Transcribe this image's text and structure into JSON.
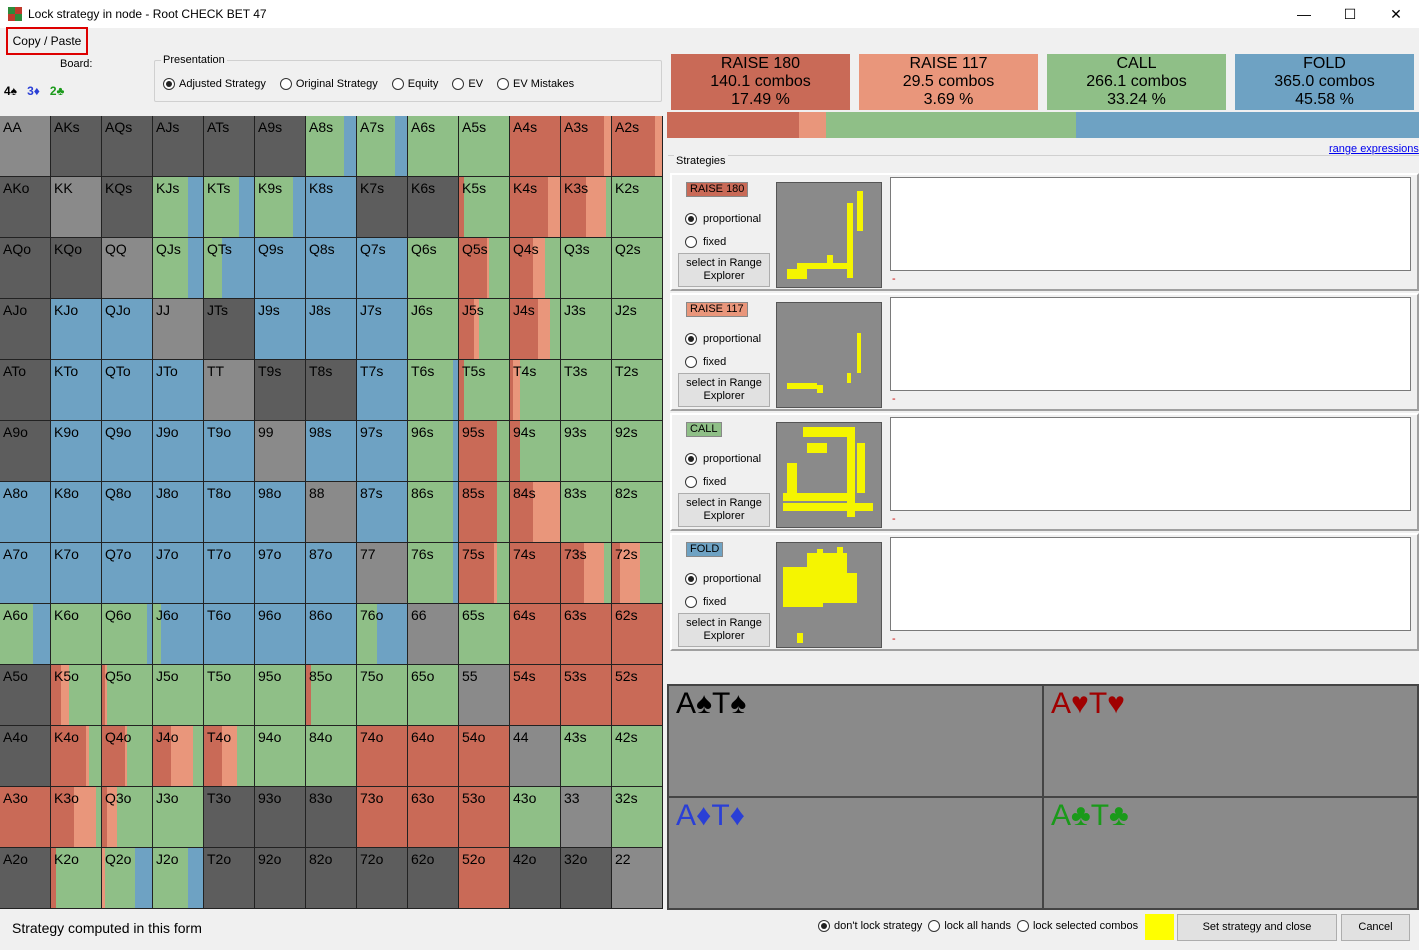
{
  "window": {
    "title": "Lock strategy in node  - Root CHECK BET 47",
    "minimize": "—",
    "maximize": "☐",
    "close": "✕"
  },
  "toolbar": {
    "copy_paste": "Copy / Paste"
  },
  "board": {
    "label": "Board:",
    "cards": [
      {
        "text": "4♠",
        "color": "#000000"
      },
      {
        "text": "3♦",
        "color": "#2a3fd6"
      },
      {
        "text": "2♣",
        "color": "#1a9a1a"
      }
    ]
  },
  "presentation": {
    "legend": "Presentation",
    "options": [
      {
        "label": "Adjusted Strategy",
        "selected": true
      },
      {
        "label": "Original Strategy",
        "selected": false
      },
      {
        "label": "Equity",
        "selected": false
      },
      {
        "label": "EV",
        "selected": false
      },
      {
        "label": "EV Mistakes",
        "selected": false
      }
    ]
  },
  "colors": {
    "raise180": "#c96a57",
    "raise117": "#e9967b",
    "call": "#8fbf87",
    "fold": "#6ea2c3",
    "empty": "#5d5d5d",
    "pair_empty": "#8a8a8a"
  },
  "actions": [
    {
      "name": "RAISE 180",
      "combos": "140.1 combos",
      "pct": "17.49 %",
      "color": "#c96a57"
    },
    {
      "name": "RAISE 117",
      "combos": "29.5 combos",
      "pct": "3.69 %",
      "color": "#e9967b"
    },
    {
      "name": "CALL",
      "combos": "266.1 combos",
      "pct": "33.24 %",
      "color": "#8fbf87"
    },
    {
      "name": "FOLD",
      "combos": "365.0 combos",
      "pct": "45.58 %",
      "color": "#6ea2c3"
    }
  ],
  "freq_bar": [
    17.49,
    3.69,
    33.24,
    45.58
  ],
  "range_expressions_link": "range expressions",
  "strategies_legend": "Strategies",
  "strategy_blocks": [
    {
      "tag": "RAISE 180",
      "color": "#c96a57",
      "proportional": "proportional",
      "fixed": "fixed",
      "select": "select in Range Explorer",
      "dash": "-"
    },
    {
      "tag": "RAISE 117",
      "color": "#e9967b",
      "proportional": "proportional",
      "fixed": "fixed",
      "select": "select in Range Explorer",
      "dash": "-"
    },
    {
      "tag": "CALL",
      "color": "#8fbf87",
      "proportional": "proportional",
      "fixed": "fixed",
      "select": "select in Range Explorer",
      "dash": "-"
    },
    {
      "tag": "FOLD",
      "color": "#6ea2c3",
      "proportional": "proportional",
      "fixed": "fixed",
      "select": "select in Range Explorer",
      "dash": "-"
    }
  ],
  "combos": [
    {
      "text": "A♠T♠",
      "color": "#000000"
    },
    {
      "text": "A♥T♥",
      "color": "#a00000"
    },
    {
      "text": "A♦T♦",
      "color": "#2a3fd6"
    },
    {
      "text": "A♣T♣",
      "color": "#1a9a1a"
    }
  ],
  "hands": [
    [
      "AA",
      "AKs",
      "AQs",
      "AJs",
      "ATs",
      "A9s",
      "A8s",
      "A7s",
      "A6s",
      "A5s",
      "A4s",
      "A3s",
      "A2s"
    ],
    [
      "AKo",
      "KK",
      "KQs",
      "KJs",
      "KTs",
      "K9s",
      "K8s",
      "K7s",
      "K6s",
      "K5s",
      "K4s",
      "K3s",
      "K2s"
    ],
    [
      "AQo",
      "KQo",
      "QQ",
      "QJs",
      "QTs",
      "Q9s",
      "Q8s",
      "Q7s",
      "Q6s",
      "Q5s",
      "Q4s",
      "Q3s",
      "Q2s"
    ],
    [
      "AJo",
      "KJo",
      "QJo",
      "JJ",
      "JTs",
      "J9s",
      "J8s",
      "J7s",
      "J6s",
      "J5s",
      "J4s",
      "J3s",
      "J2s"
    ],
    [
      "ATo",
      "KTo",
      "QTo",
      "JTo",
      "TT",
      "T9s",
      "T8s",
      "T7s",
      "T6s",
      "T5s",
      "T4s",
      "T3s",
      "T2s"
    ],
    [
      "A9o",
      "K9o",
      "Q9o",
      "J9o",
      "T9o",
      "99",
      "98s",
      "97s",
      "96s",
      "95s",
      "94s",
      "93s",
      "92s"
    ],
    [
      "A8o",
      "K8o",
      "Q8o",
      "J8o",
      "T8o",
      "98o",
      "88",
      "87s",
      "86s",
      "85s",
      "84s",
      "83s",
      "82s"
    ],
    [
      "A7o",
      "K7o",
      "Q7o",
      "J7o",
      "T7o",
      "97o",
      "87o",
      "77",
      "76s",
      "75s",
      "74s",
      "73s",
      "72s"
    ],
    [
      "A6o",
      "K6o",
      "Q6o",
      "J6o",
      "T6o",
      "96o",
      "86o",
      "76o",
      "66",
      "65s",
      "64s",
      "63s",
      "62s"
    ],
    [
      "A5o",
      "K5o",
      "Q5o",
      "J5o",
      "T5o",
      "95o",
      "85o",
      "75o",
      "65o",
      "55",
      "54s",
      "53s",
      "52s"
    ],
    [
      "A4o",
      "K4o",
      "Q4o",
      "J4o",
      "T4o",
      "94o",
      "84o",
      "74o",
      "64o",
      "54o",
      "44",
      "43s",
      "42s"
    ],
    [
      "A3o",
      "K3o",
      "Q3o",
      "J3o",
      "T3o",
      "93o",
      "83o",
      "73o",
      "63o",
      "53o",
      "43o",
      "33",
      "32s"
    ],
    [
      "A2o",
      "K2o",
      "Q2o",
      "J2o",
      "T2o",
      "92o",
      "82o",
      "72o",
      "62o",
      "52o",
      "42o",
      "32o",
      "22"
    ]
  ],
  "strategy": [
    [
      [
        0,
        0,
        0,
        0
      ],
      [
        0,
        0,
        0,
        0
      ],
      [
        0,
        0,
        0,
        0
      ],
      [
        0,
        0,
        0,
        0
      ],
      [
        0,
        0,
        0,
        0
      ],
      [
        0,
        0,
        0,
        0
      ],
      [
        0,
        0,
        75,
        25
      ],
      [
        0,
        0,
        75,
        25
      ],
      [
        0,
        0,
        100,
        0
      ],
      [
        0,
        0,
        100,
        0
      ],
      [
        100,
        0,
        0,
        0
      ],
      [
        85,
        15,
        0,
        0
      ],
      [
        85,
        15,
        0,
        0
      ]
    ],
    [
      [
        0,
        0,
        0,
        0
      ],
      [
        0,
        0,
        0,
        0
      ],
      [
        0,
        0,
        0,
        0
      ],
      [
        0,
        0,
        70,
        30
      ],
      [
        0,
        0,
        70,
        30
      ],
      [
        0,
        0,
        75,
        25
      ],
      [
        0,
        0,
        0,
        100
      ],
      [
        0,
        0,
        0,
        0
      ],
      [
        0,
        0,
        0,
        0
      ],
      [
        10,
        0,
        90,
        0
      ],
      [
        75,
        25,
        0,
        0
      ],
      [
        50,
        40,
        10,
        0
      ],
      [
        0,
        0,
        100,
        0
      ]
    ],
    [
      [
        0,
        0,
        0,
        0
      ],
      [
        0,
        0,
        0,
        0
      ],
      [
        0,
        0,
        0,
        0
      ],
      [
        0,
        0,
        70,
        30
      ],
      [
        0,
        0,
        35,
        65
      ],
      [
        0,
        0,
        0,
        100
      ],
      [
        0,
        0,
        0,
        100
      ],
      [
        0,
        0,
        0,
        100
      ],
      [
        0,
        0,
        100,
        0
      ],
      [
        55,
        5,
        40,
        0
      ],
      [
        45,
        25,
        30,
        0
      ],
      [
        0,
        0,
        100,
        0
      ],
      [
        0,
        0,
        100,
        0
      ]
    ],
    [
      [
        0,
        0,
        0,
        0
      ],
      [
        0,
        0,
        0,
        100
      ],
      [
        0,
        0,
        0,
        100
      ],
      [
        0,
        0,
        0,
        0
      ],
      [
        0,
        0,
        0,
        0
      ],
      [
        0,
        0,
        0,
        100
      ],
      [
        0,
        0,
        0,
        100
      ],
      [
        0,
        0,
        0,
        100
      ],
      [
        0,
        0,
        100,
        0
      ],
      [
        30,
        10,
        60,
        0
      ],
      [
        55,
        25,
        20,
        0
      ],
      [
        0,
        0,
        100,
        0
      ],
      [
        0,
        0,
        100,
        0
      ]
    ],
    [
      [
        0,
        0,
        0,
        0
      ],
      [
        0,
        0,
        0,
        100
      ],
      [
        0,
        0,
        0,
        100
      ],
      [
        0,
        0,
        0,
        100
      ],
      [
        0,
        0,
        0,
        0
      ],
      [
        0,
        0,
        0,
        0
      ],
      [
        0,
        0,
        0,
        0
      ],
      [
        0,
        0,
        0,
        100
      ],
      [
        0,
        0,
        90,
        10
      ],
      [
        10,
        0,
        90,
        0
      ],
      [
        5,
        15,
        80,
        0
      ],
      [
        0,
        0,
        100,
        0
      ],
      [
        0,
        0,
        100,
        0
      ]
    ],
    [
      [
        0,
        0,
        0,
        0
      ],
      [
        0,
        0,
        0,
        100
      ],
      [
        0,
        0,
        0,
        100
      ],
      [
        0,
        0,
        0,
        100
      ],
      [
        0,
        0,
        0,
        100
      ],
      [
        0,
        0,
        0,
        0
      ],
      [
        0,
        0,
        0,
        100
      ],
      [
        0,
        0,
        0,
        100
      ],
      [
        0,
        0,
        90,
        10
      ],
      [
        75,
        0,
        25,
        0
      ],
      [
        20,
        0,
        80,
        0
      ],
      [
        0,
        0,
        100,
        0
      ],
      [
        0,
        0,
        100,
        0
      ]
    ],
    [
      [
        0,
        0,
        0,
        100
      ],
      [
        0,
        0,
        0,
        100
      ],
      [
        0,
        0,
        0,
        100
      ],
      [
        0,
        0,
        0,
        100
      ],
      [
        0,
        0,
        0,
        100
      ],
      [
        0,
        0,
        0,
        100
      ],
      [
        0,
        0,
        0,
        0
      ],
      [
        0,
        0,
        0,
        100
      ],
      [
        0,
        0,
        90,
        10
      ],
      [
        75,
        0,
        25,
        0
      ],
      [
        45,
        55,
        0,
        0
      ],
      [
        0,
        0,
        100,
        0
      ],
      [
        0,
        0,
        100,
        0
      ]
    ],
    [
      [
        0,
        0,
        0,
        100
      ],
      [
        0,
        0,
        0,
        100
      ],
      [
        0,
        0,
        0,
        100
      ],
      [
        0,
        0,
        0,
        100
      ],
      [
        0,
        0,
        0,
        100
      ],
      [
        0,
        0,
        0,
        100
      ],
      [
        0,
        0,
        0,
        100
      ],
      [
        0,
        0,
        0,
        0
      ],
      [
        0,
        0,
        90,
        10
      ],
      [
        70,
        5,
        25,
        0
      ],
      [
        100,
        0,
        0,
        0
      ],
      [
        45,
        40,
        15,
        0
      ],
      [
        15,
        40,
        45,
        0
      ]
    ],
    [
      [
        0,
        0,
        65,
        35
      ],
      [
        0,
        0,
        100,
        0
      ],
      [
        0,
        0,
        90,
        10
      ],
      [
        0,
        0,
        15,
        85
      ],
      [
        0,
        0,
        0,
        100
      ],
      [
        0,
        0,
        0,
        100
      ],
      [
        0,
        0,
        0,
        100
      ],
      [
        0,
        0,
        40,
        60
      ],
      [
        0,
        0,
        0,
        0
      ],
      [
        0,
        0,
        100,
        0
      ],
      [
        100,
        0,
        0,
        0
      ],
      [
        100,
        0,
        0,
        0
      ],
      [
        100,
        0,
        0,
        0
      ]
    ],
    [
      [
        0,
        0,
        0,
        0
      ],
      [
        20,
        15,
        65,
        0
      ],
      [
        5,
        5,
        90,
        0
      ],
      [
        0,
        0,
        100,
        0
      ],
      [
        0,
        0,
        100,
        0
      ],
      [
        0,
        0,
        100,
        0
      ],
      [
        10,
        0,
        90,
        0
      ],
      [
        0,
        0,
        100,
        0
      ],
      [
        0,
        0,
        100,
        0
      ],
      [
        0,
        0,
        0,
        0
      ],
      [
        100,
        0,
        0,
        0
      ],
      [
        100,
        0,
        0,
        0
      ],
      [
        100,
        0,
        0,
        0
      ]
    ],
    [
      [
        0,
        0,
        0,
        0
      ],
      [
        70,
        5,
        25,
        0
      ],
      [
        45,
        5,
        50,
        0
      ],
      [
        35,
        45,
        20,
        0
      ],
      [
        35,
        30,
        35,
        0
      ],
      [
        0,
        0,
        100,
        0
      ],
      [
        0,
        0,
        100,
        0
      ],
      [
        100,
        0,
        0,
        0
      ],
      [
        100,
        0,
        0,
        0
      ],
      [
        100,
        0,
        0,
        0
      ],
      [
        0,
        0,
        0,
        0
      ],
      [
        0,
        0,
        100,
        0
      ],
      [
        0,
        0,
        100,
        0
      ]
    ],
    [
      [
        100,
        0,
        0,
        0
      ],
      [
        45,
        45,
        10,
        0
      ],
      [
        10,
        20,
        70,
        0
      ],
      [
        0,
        0,
        100,
        0
      ],
      [
        0,
        0,
        0,
        0
      ],
      [
        0,
        0,
        0,
        0
      ],
      [
        0,
        0,
        0,
        0
      ],
      [
        100,
        0,
        0,
        0
      ],
      [
        100,
        0,
        0,
        0
      ],
      [
        100,
        0,
        0,
        0
      ],
      [
        0,
        0,
        100,
        0
      ],
      [
        0,
        0,
        0,
        0
      ],
      [
        0,
        0,
        100,
        0
      ]
    ],
    [
      [
        0,
        0,
        0,
        0
      ],
      [
        10,
        0,
        90,
        0
      ],
      [
        0,
        5,
        60,
        35
      ],
      [
        0,
        0,
        70,
        30
      ],
      [
        0,
        0,
        0,
        0
      ],
      [
        0,
        0,
        0,
        0
      ],
      [
        0,
        0,
        0,
        0
      ],
      [
        0,
        0,
        0,
        0
      ],
      [
        0,
        0,
        0,
        0
      ],
      [
        100,
        0,
        0,
        0
      ],
      [
        0,
        0,
        0,
        0
      ],
      [
        0,
        0,
        0,
        0
      ],
      [
        0,
        0,
        0,
        0
      ]
    ]
  ],
  "status": "Strategy computed in this form",
  "lock_options": [
    {
      "label": "don't lock strategy",
      "selected": true
    },
    {
      "label": "lock all hands",
      "selected": false
    },
    {
      "label": "lock selected combos",
      "selected": false
    }
  ],
  "buttons": {
    "set_close": "Set strategy and close",
    "cancel": "Cancel"
  }
}
